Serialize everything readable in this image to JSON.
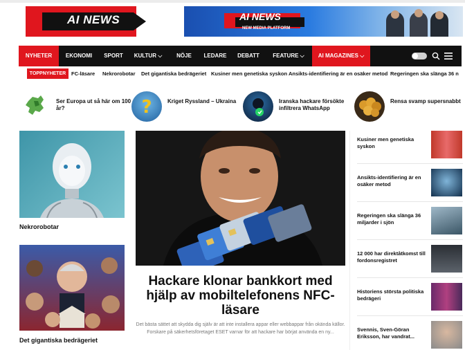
{
  "site": {
    "logo_text": "AI NEWS",
    "accent": "#e0161e"
  },
  "banner": {
    "title": "AI NEWS",
    "subtitle": "NEW MEDIA PLATFORM"
  },
  "nav": {
    "items": [
      "NYHETER",
      "EKONOMI",
      "SPORT",
      "KULTUR",
      "NÖJE",
      "LEDARE",
      "DEBATT",
      "FEATURE",
      "AI MAGAZINES"
    ],
    "dropdown_marker": "⌵"
  },
  "ticker": {
    "label": "TOPPNYHETER",
    "items": [
      "FC-läsare",
      "Nekrorobotar",
      "Det gigantiska bedrägeriet",
      "Kusiner men genetiska syskon",
      "Ansikts-identifiering är en osäker metod",
      "Regeringen ska slänga 36 n"
    ]
  },
  "trending": [
    {
      "title": "Ser Europa ut så här om 100 år?",
      "icon": "europe-map"
    },
    {
      "title": "Kriget Ryssland – Ukraina",
      "icon": "question-mark"
    },
    {
      "title": "Iranska hackare försökte infiltrera WhatsApp",
      "icon": "whatsapp-hacker"
    },
    {
      "title": "Rensa svamp supersnabbt",
      "icon": "mushroom-basket"
    }
  ],
  "left_cards": [
    {
      "title": "Nekrorobotar"
    },
    {
      "title": "Det gigantiska bedrägeriet"
    }
  ],
  "main_article": {
    "title": "Hackare klonar bankkort med hjälp av mobiltelefonens NFC-läsare",
    "excerpt": "Det bästa sättet att skydda dig själv är att inte installera appar eller webbappar från okända källor. Forskare på säkerhetsföretaget ESET varnar för att hackare har börjat använda en ny..."
  },
  "right_list": [
    {
      "title": "Kusiner men genetiska syskon"
    },
    {
      "title": "Ansikts-identifiering är en osäker metod"
    },
    {
      "title": "Regeringen ska slänga 36 miljarder i sjön"
    },
    {
      "title": "12 000 har direktåtkomst till fordonsregistret"
    },
    {
      "title": "Historiens största politiska bedrägeri"
    },
    {
      "title": "Svennis, Sven-Göran Eriksson, har vandrat..."
    }
  ]
}
